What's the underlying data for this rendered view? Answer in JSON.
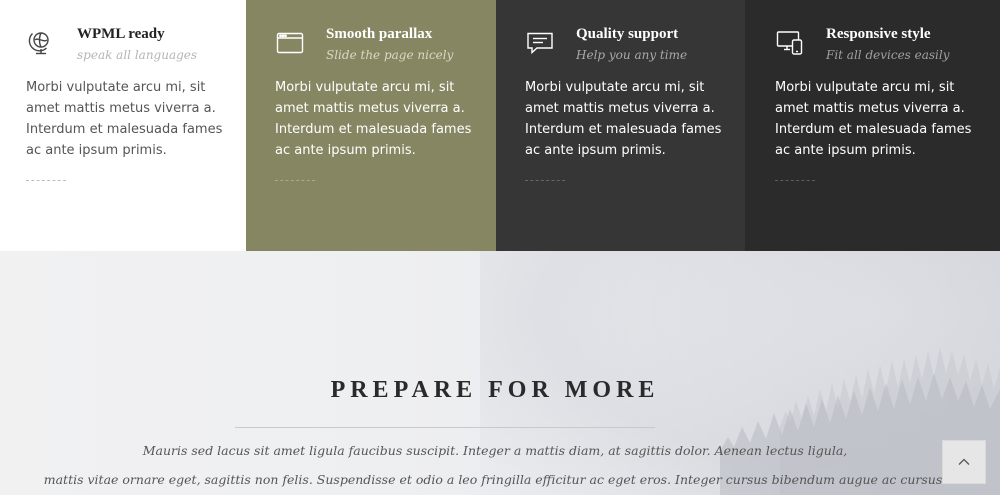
{
  "features": [
    {
      "icon": "globe-icon",
      "title": "WPML ready",
      "subtitle": "speak all languages",
      "text": "Morbi vulputate arcu mi, sit amet mattis metus viverra a. Interdum et malesuada fames ac ante ipsum primis.",
      "background": "#ffffff"
    },
    {
      "icon": "browser-window-icon",
      "title": "Smooth parallax",
      "subtitle": "Slide the page nicely",
      "text": "Morbi vulputate arcu mi, sit amet mattis metus viverra a. Interdum et malesuada fames ac ante ipsum primis.",
      "background": "#868762"
    },
    {
      "icon": "chat-bubble-icon",
      "title": "Quality support",
      "subtitle": "Help you any time",
      "text": "Morbi vulputate arcu mi, sit amet mattis metus viverra a. Interdum et malesuada fames ac ante ipsum primis.",
      "background": "#363636"
    },
    {
      "icon": "devices-icon",
      "title": "Responsive style",
      "subtitle": "Fit all devices easily",
      "text": "Morbi vulputate arcu mi, sit amet mattis metus viverra a. Interdum et malesuada fames ac ante ipsum primis.",
      "background": "#2b2b2b"
    }
  ],
  "hero": {
    "title": "PREPARE FOR MORE",
    "line1": "Mauris sed lacus sit amet ligula faucibus suscipit. Integer a mattis diam, at sagittis dolor. Aenean lectus ligula,",
    "line2": "mattis vitae ornare eget, sagittis non felis. Suspendisse et odio a leo fringilla efficitur ac eget eros. Integer cursus bibendum augue ac cursus."
  },
  "scroll_top": {
    "icon": "chevron-up-icon"
  }
}
